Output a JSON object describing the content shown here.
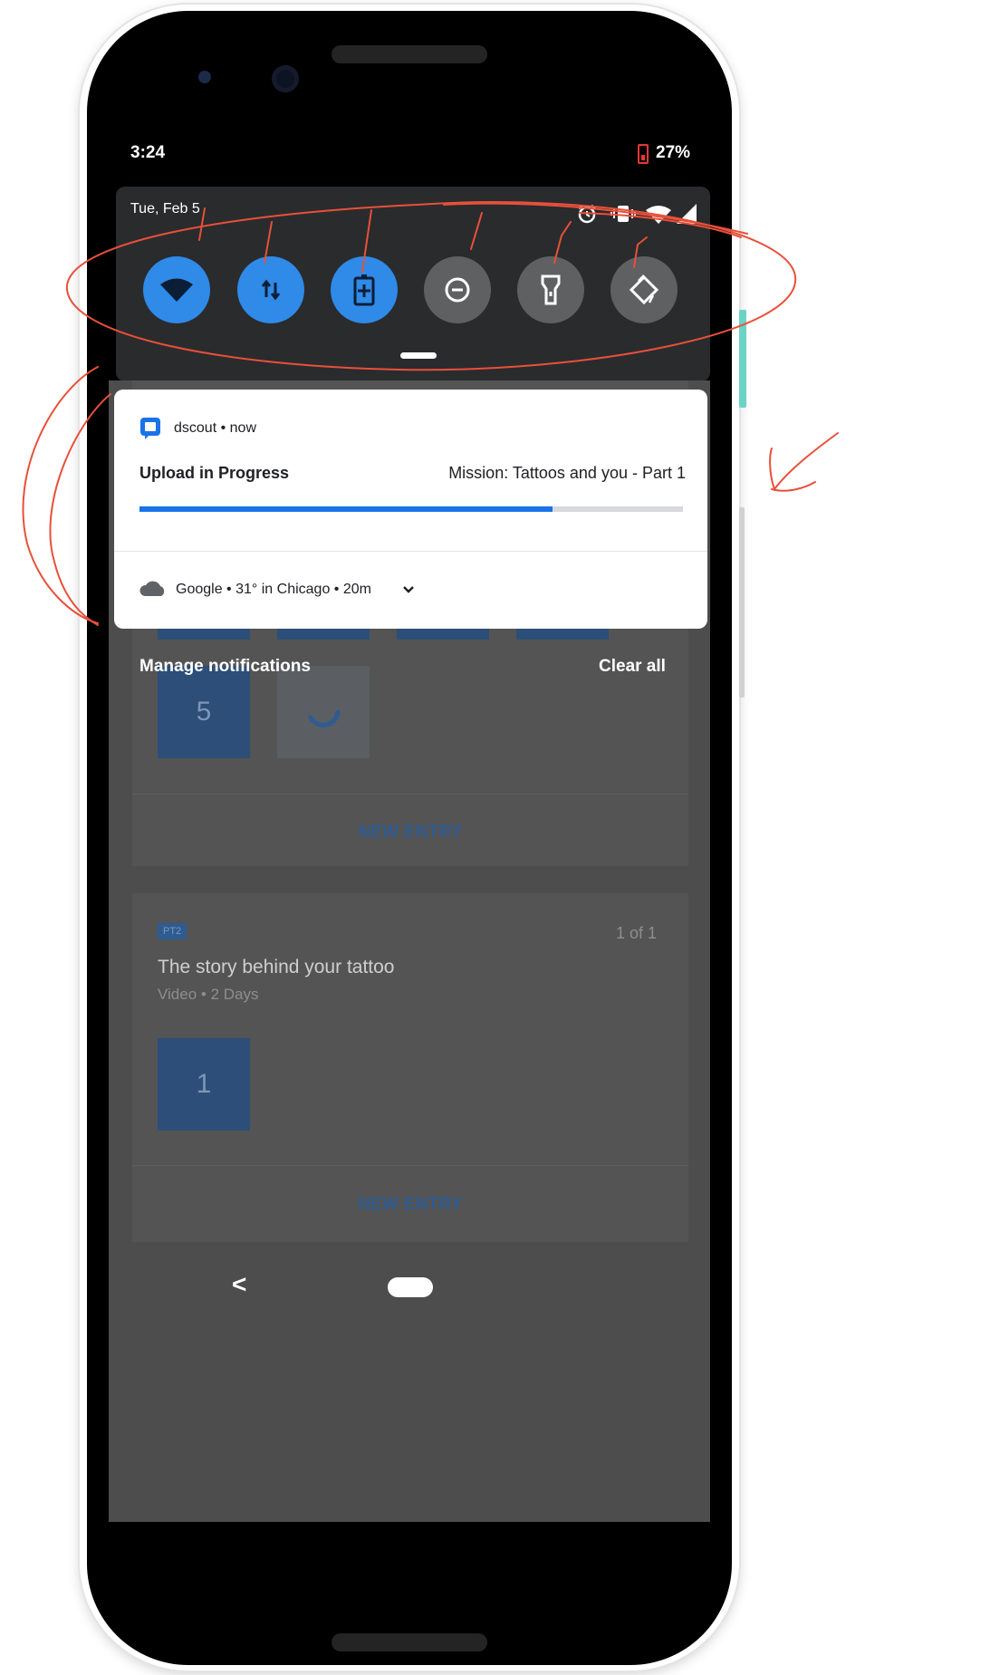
{
  "status_bar": {
    "time": "3:24",
    "battery_percent": "27%"
  },
  "quick_settings": {
    "date": "Tue, Feb 5",
    "tiles": [
      {
        "icon": "wifi-icon",
        "state": "on"
      },
      {
        "icon": "mobile-data-icon",
        "state": "on"
      },
      {
        "icon": "battery-saver-icon",
        "state": "on"
      },
      {
        "icon": "do-not-disturb-icon",
        "state": "off"
      },
      {
        "icon": "flashlight-icon",
        "state": "off"
      },
      {
        "icon": "auto-rotate-icon",
        "state": "off"
      }
    ],
    "status_icons": [
      "alarm-icon",
      "vibrate-icon",
      "wifi-icon",
      "signal-icon"
    ]
  },
  "notifications": {
    "upload": {
      "app": "dscout",
      "time": "now",
      "title": "Upload in Progress",
      "subtitle": "Mission: Tattoos and you - Part 1",
      "progress": 0.76
    },
    "weather": {
      "app": "Google",
      "detail": "31° in Chicago",
      "time": "20m"
    }
  },
  "shade_actions": {
    "manage": "Manage notifications",
    "clear_all": "Clear all"
  },
  "background_app": {
    "entry_1": {
      "thumb_count": "5",
      "new_entry": "NEW ENTRY"
    },
    "entry_2": {
      "badge": "PT2",
      "counter": "1 of 1",
      "title": "The story behind your tattoo",
      "meta": "Video • 2 Days",
      "thumb_count": "1",
      "new_entry": "NEW ENTRY"
    }
  },
  "nav_bar": {
    "back": "<"
  },
  "colors": {
    "accent": "#2f8ae8",
    "annotation": "#e8503a",
    "panel": "#2a2b2d"
  }
}
